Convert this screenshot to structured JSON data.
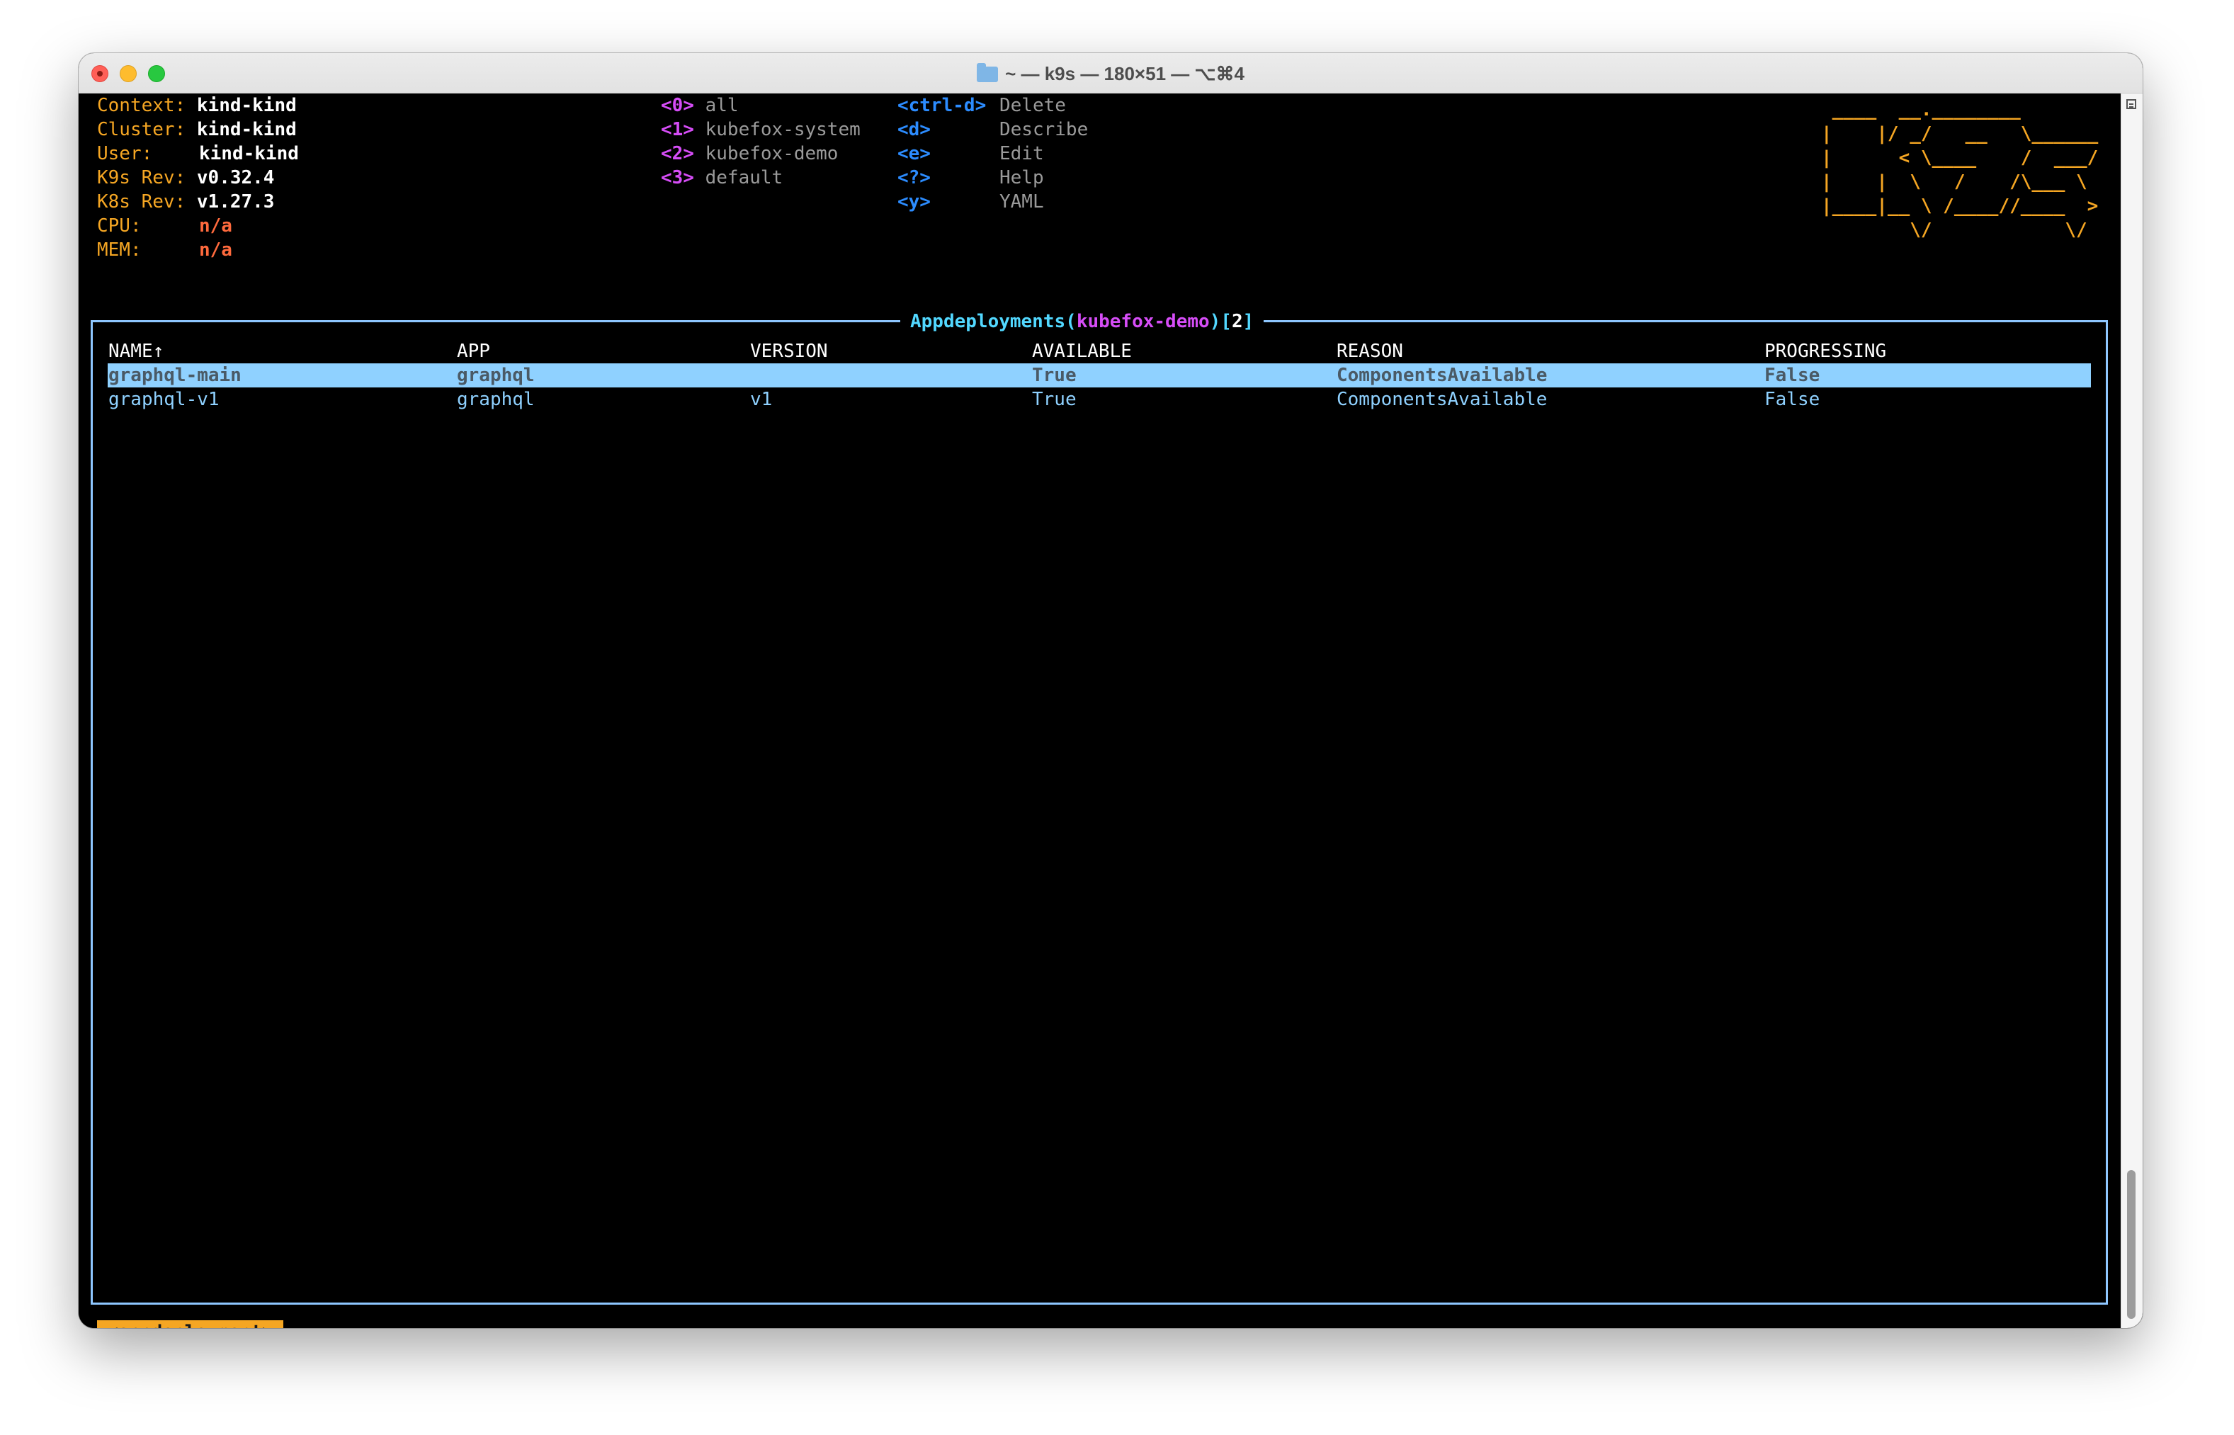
{
  "window": {
    "title": "~ — k9s — 180×51 — ⌥⌘4"
  },
  "header": {
    "context": {
      "label": "Context:",
      "value": "kind-kind"
    },
    "cluster": {
      "label": "Cluster:",
      "value": "kind-kind"
    },
    "user": {
      "label": "User:",
      "value": "kind-kind"
    },
    "k9s_rev": {
      "label": "K9s Rev:",
      "value": "v0.32.4"
    },
    "k8s_rev": {
      "label": "K8s Rev:",
      "value": "v1.27.3"
    },
    "cpu": {
      "label": "CPU:",
      "value": "n/a"
    },
    "mem": {
      "label": "MEM:",
      "value": "n/a"
    }
  },
  "namespaces": [
    {
      "key": "<0>",
      "name": "all"
    },
    {
      "key": "<1>",
      "name": "kubefox-system"
    },
    {
      "key": "<2>",
      "name": "kubefox-demo"
    },
    {
      "key": "<3>",
      "name": "default"
    }
  ],
  "hotkeys": [
    {
      "key": "<ctrl-d>",
      "name": "Delete"
    },
    {
      "key": "<d>",
      "name": "Describe"
    },
    {
      "key": "<e>",
      "name": "Edit"
    },
    {
      "key": "<?>",
      "name": "Help"
    },
    {
      "key": "<y>",
      "name": "YAML"
    }
  ],
  "logo": [
    " ____  __.________       ",
    "|    |/ _/   __   \\______",
    "|      < \\____    /  ___/",
    "|    |  \\   /    /\\___ \\ ",
    "|____|__ \\ /____//____  >",
    "        \\/            \\/ "
  ],
  "table": {
    "resource": "Appdeployments",
    "namespace": "kubefox-demo",
    "count": "2",
    "columns": [
      "NAME↑",
      "APP",
      "VERSION",
      "AVAILABLE",
      "REASON",
      "PROGRESSING"
    ],
    "rows": [
      {
        "name": "graphql-main",
        "app": "graphql",
        "version": "",
        "available": "True",
        "reason": "ComponentsAvailable",
        "progressing": "False",
        "selected": true
      },
      {
        "name": "graphql-v1",
        "app": "graphql",
        "version": "v1",
        "available": "True",
        "reason": "ComponentsAvailable",
        "progressing": "False",
        "selected": false
      }
    ]
  },
  "breadcrumb": "<appdeployment>",
  "colors": {
    "label": "#f5a623",
    "namespace_key": "#d64df7",
    "hotkey_key": "#2c8cff",
    "border": "#8ec7ff",
    "selection": "#8fd1ff"
  }
}
